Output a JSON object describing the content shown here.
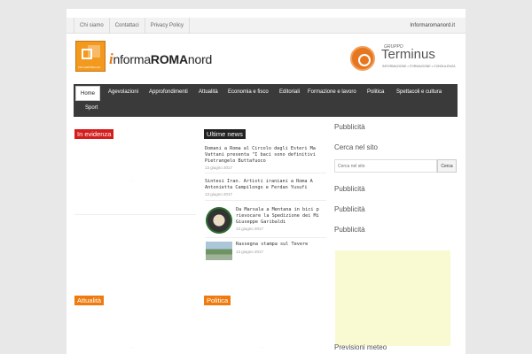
{
  "topbar": {
    "links": [
      "Chi siamo",
      "Contattaci",
      "Privacy Policy"
    ],
    "domain": "Informaromanord.it"
  },
  "header": {
    "logo": {
      "i": "i",
      "informa": "nforma",
      "roma": "ROMA",
      "nord": "nord",
      "badge_caption": "InformaROMAnord"
    },
    "banner": {
      "gruppo": "GRUPPO",
      "name": "Terminus",
      "tagline": "INFORMAZIONE • FORMAZIONE • CONSULENZA"
    }
  },
  "nav": {
    "items": [
      "Home",
      "Agevolazioni",
      "Approfondimenti",
      "Attualità",
      "Economia e fisco",
      "Editoriali",
      "Formazione e lavoro",
      "Politica",
      "Spettacoli e cultura",
      "Sport"
    ],
    "active": "Home"
  },
  "sections": {
    "evidenza": "In evidenza",
    "ultime": "Ultime news",
    "attualita": "Attualità",
    "politica": "Politica"
  },
  "news": [
    {
      "line1": "Domani a Roma al Circolo degli Esteri Ma",
      "line2": "Vattani presenta \"I baci sono definitivi",
      "line3": "Pietrangelo Buttafuoco",
      "date": "13 giugno 2017"
    },
    {
      "line1": "Sintesi Iran. Artisti iraniani a Roma A",
      "line2": "Antonietta Campilongo e Ferdan Yusufi",
      "line3": "",
      "date": "13 giugno 2017"
    },
    {
      "line1": "Da Marsala a Mentana in bici p",
      "line2": "rievocare la Spedizione dei Mi",
      "line3": "Giuseppe Garibaldi",
      "date": "13 giugno 2017"
    },
    {
      "line1": "Rassegna stampa sul Tevere",
      "line2": "",
      "line3": "",
      "date": "13 giugno 2017"
    }
  ],
  "sidebar": {
    "pubblicita": "Pubblicità",
    "cerca_title": "Cerca nel sito",
    "search_placeholder": "Cerca nel sito",
    "search_button": "Cerca",
    "meteo": "Previsioni meteo"
  },
  "colors": {
    "accent_red": "#d51d1d",
    "accent_orange": "#ef7b0f",
    "nav_bg": "#3a3a3a"
  }
}
